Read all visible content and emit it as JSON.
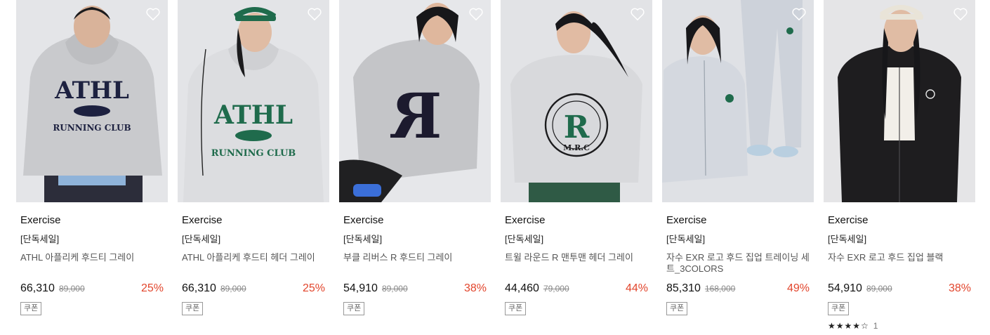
{
  "products": [
    {
      "brand": "Exercise",
      "tag": "[단독세일]",
      "name": "ATHL 아플리케 후드티 그레이",
      "price": "66,310",
      "original_price": "89,000",
      "discount": "25%",
      "coupon": "쿠폰",
      "garment_text": "ATHL",
      "garment_sub": "RUNNING CLUB"
    },
    {
      "brand": "Exercise",
      "tag": "[단독세일]",
      "name": "ATHL 아플리케 후드티 헤더 그레이",
      "price": "66,310",
      "original_price": "89,000",
      "discount": "25%",
      "coupon": "쿠폰",
      "garment_text": "ATHL",
      "garment_sub": "RUNNING CLUB"
    },
    {
      "brand": "Exercise",
      "tag": "[단독세일]",
      "name": "부클 리버스 R 후드티 그레이",
      "price": "54,910",
      "original_price": "89,000",
      "discount": "38%",
      "coupon": "쿠폰",
      "garment_text": "R",
      "garment_sub": ""
    },
    {
      "brand": "Exercise",
      "tag": "[단독세일]",
      "name": "트윌 라운드 R 맨투맨 헤더 그레이",
      "price": "44,460",
      "original_price": "79,000",
      "discount": "44%",
      "coupon": "쿠폰",
      "garment_text": "R",
      "garment_sub": "M.R.C"
    },
    {
      "brand": "Exercise",
      "tag": "[단독세일]",
      "name": "자수 EXR 로고 후드 집업 트레이닝 세트_3COLORS",
      "price": "85,310",
      "original_price": "168,000",
      "discount": "49%",
      "coupon": "쿠폰",
      "garment_text": "",
      "garment_sub": ""
    },
    {
      "brand": "Exercise",
      "tag": "[단독세일]",
      "name": "자수 EXR 로고 후드 집업 블랙",
      "price": "54,910",
      "original_price": "89,000",
      "discount": "38%",
      "coupon": "쿠폰",
      "garment_text": "",
      "garment_sub": "",
      "rating_stars": "★★★★☆",
      "rating": 4,
      "review_count": "1"
    }
  ],
  "colors": {
    "discount": "#e2452c",
    "heather": "#cfd0d2",
    "navy": "#1d2140",
    "green": "#1f6b4c",
    "black": "#1c1c1e"
  },
  "icons": {
    "wishlist": "heart-outline-icon",
    "rating": "star-icon"
  }
}
